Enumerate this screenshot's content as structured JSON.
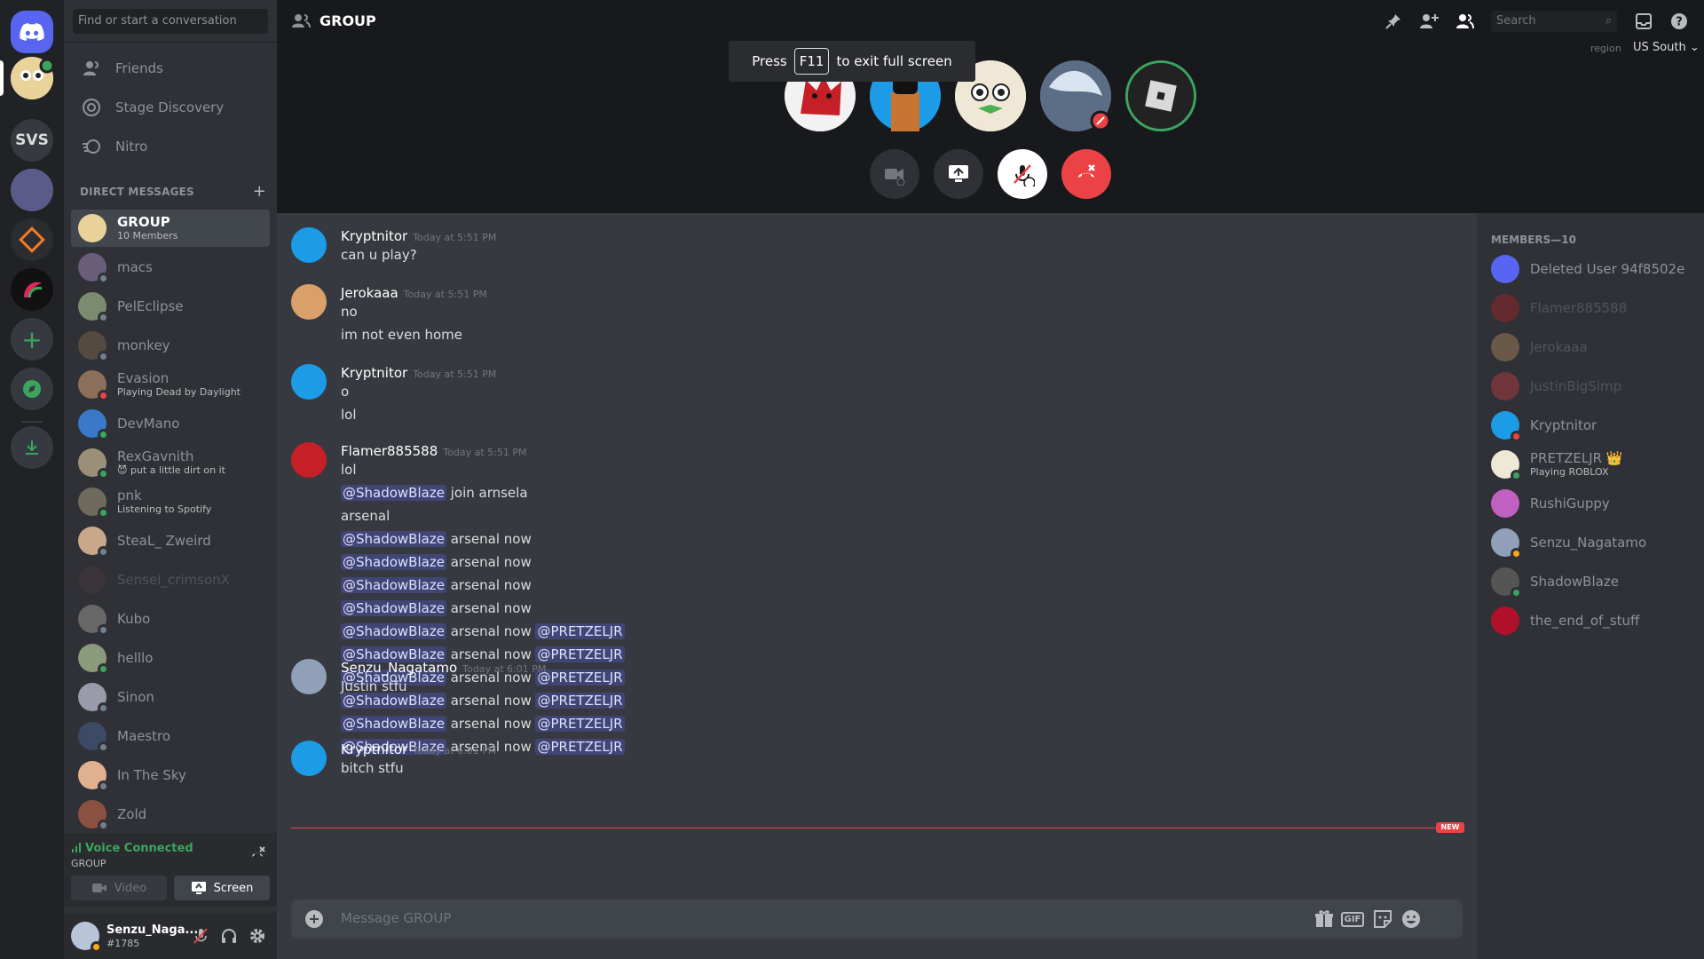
{
  "sidebar": {
    "search_placeholder": "Find or start a conversation",
    "nav": [
      {
        "label": "Friends",
        "icon": "friends-icon"
      },
      {
        "label": "Stage Discovery",
        "icon": "stage-icon"
      },
      {
        "label": "Nitro",
        "icon": "nitro-icon"
      }
    ],
    "dm_header": "DIRECT MESSAGES",
    "dms": [
      {
        "name": "GROUP",
        "sub": "10 Members",
        "status": "",
        "active": true
      },
      {
        "name": "macs",
        "sub": "",
        "status": "off"
      },
      {
        "name": "PelEclipse",
        "sub": "",
        "status": "off"
      },
      {
        "name": "monkey",
        "sub": "",
        "status": "off"
      },
      {
        "name": "Evasion",
        "sub": "Playing Dead by Daylight",
        "status": "dnd"
      },
      {
        "name": "DevMano",
        "sub": "",
        "status": "on"
      },
      {
        "name": "RexGavnith",
        "sub": "😈 put a little dirt on it",
        "status": "on"
      },
      {
        "name": "pnk",
        "sub": "Listening to Spotify",
        "status": "on"
      },
      {
        "name": "SteaL_ Zweird",
        "sub": "",
        "status": "off"
      },
      {
        "name": "Sensei_crimsonX",
        "sub": "",
        "status": "",
        "dim": true
      },
      {
        "name": "Kubo",
        "sub": "",
        "status": "off"
      },
      {
        "name": "helllo",
        "sub": "",
        "status": "on"
      },
      {
        "name": "Sinon",
        "sub": "",
        "status": "off"
      },
      {
        "name": "Maestro",
        "sub": "",
        "status": "off"
      },
      {
        "name": "In The Sky",
        "sub": "",
        "status": "off"
      },
      {
        "name": "Zold",
        "sub": "",
        "status": "off"
      }
    ],
    "voice_title": "Voice Connected",
    "voice_sub": "GROUP",
    "video_label": "Video",
    "screen_label": "Screen",
    "user_name": "Senzu_Naga...",
    "user_tag": "#1785"
  },
  "servers": [
    {
      "label": "SVS"
    }
  ],
  "header": {
    "title": "GROUP",
    "search_placeholder": "Search",
    "region_label": "region",
    "region_value": "US South ⌄"
  },
  "overlay": {
    "pre": "Press",
    "key": "F11",
    "post": "to exit full screen"
  },
  "messages": [
    {
      "author": "Kryptnitor",
      "time": "Today at 5:51 PM",
      "lines": [
        [
          {
            "t": "can u play?"
          }
        ]
      ]
    },
    {
      "author": "Jerokaaa",
      "time": "Today at 5:51 PM",
      "lines": [
        [
          {
            "t": "no"
          }
        ],
        [
          {
            "t": "im not even home"
          }
        ]
      ]
    },
    {
      "author": "Kryptnitor",
      "time": "Today at 5:51 PM",
      "lines": [
        [
          {
            "t": "o"
          }
        ],
        [
          {
            "t": "lol"
          }
        ]
      ]
    },
    {
      "author": "Flamer885588",
      "time": "Today at 5:51 PM",
      "lines": [
        [
          {
            "t": "lol"
          }
        ],
        [
          {
            "m": "@ShadowBlaze"
          },
          {
            "t": " join arnsela"
          }
        ],
        [
          {
            "t": "arsenal"
          }
        ],
        [
          {
            "m": "@ShadowBlaze"
          },
          {
            "t": " arsenal now"
          }
        ],
        [
          {
            "m": "@ShadowBlaze"
          },
          {
            "t": " arsenal now"
          }
        ],
        [
          {
            "m": "@ShadowBlaze"
          },
          {
            "t": " arsenal now"
          }
        ],
        [
          {
            "m": "@ShadowBlaze"
          },
          {
            "t": " arsenal now"
          }
        ],
        [
          {
            "m": "@ShadowBlaze"
          },
          {
            "t": " arsenal now "
          },
          {
            "m": "@PRETZELJR"
          }
        ],
        [
          {
            "m": "@ShadowBlaze"
          },
          {
            "t": " arsenal now "
          },
          {
            "m": "@PRETZELJR"
          }
        ],
        [
          {
            "m": "@ShadowBlaze"
          },
          {
            "t": " arsenal now "
          },
          {
            "m": "@PRETZELJR"
          }
        ],
        [
          {
            "m": "@ShadowBlaze"
          },
          {
            "t": " arsenal now "
          },
          {
            "m": "@PRETZELJR"
          }
        ],
        [
          {
            "m": "@ShadowBlaze"
          },
          {
            "t": " arsenal now "
          },
          {
            "m": "@PRETZELJR"
          }
        ],
        [
          {
            "m": "@ShadowBlaze"
          },
          {
            "t": " arsenal now "
          },
          {
            "m": "@PRETZELJR"
          }
        ]
      ]
    },
    {
      "author": "Senzu_Nagatamo",
      "time": "Today at 6:01 PM",
      "lines": [
        [
          {
            "t": "Justin stfu"
          }
        ]
      ]
    },
    {
      "author": "Kryptnitor",
      "time": "Today at 6:01 PM",
      "lines": [
        [
          {
            "t": "bitch stfu"
          }
        ]
      ]
    }
  ],
  "new_badge": "NEW",
  "composer": {
    "placeholder": "Message GROUP",
    "gif": "GIF"
  },
  "members": {
    "title": "MEMBERS—10",
    "list": [
      {
        "name": "Deleted User 94f8502e",
        "sub": "",
        "status": "",
        "dim": false
      },
      {
        "name": "Flamer885588",
        "sub": "",
        "status": "",
        "dim": true
      },
      {
        "name": "Jerokaaa",
        "sub": "",
        "status": "",
        "dim": true
      },
      {
        "name": "JustinBigSimp",
        "sub": "",
        "status": "",
        "dim": true
      },
      {
        "name": "Kryptnitor",
        "sub": "",
        "status": "dnd",
        "dim": false
      },
      {
        "name": "PRETZELJR 👑",
        "sub": "Playing ROBLOX",
        "status": "on",
        "dim": false
      },
      {
        "name": "RushiGuppy",
        "sub": "",
        "status": "",
        "dim": false
      },
      {
        "name": "Senzu_Nagatamo",
        "sub": "",
        "status": "idle",
        "dim": false
      },
      {
        "name": "ShadowBlaze",
        "sub": "",
        "status": "on",
        "dim": false
      },
      {
        "name": "the_end_of_stuff",
        "sub": "",
        "status": "",
        "dim": false
      }
    ]
  },
  "colors": {
    "blurple": "#5865f2",
    "green": "#3ba55d",
    "red": "#ed4245",
    "bg": "#36393f"
  }
}
